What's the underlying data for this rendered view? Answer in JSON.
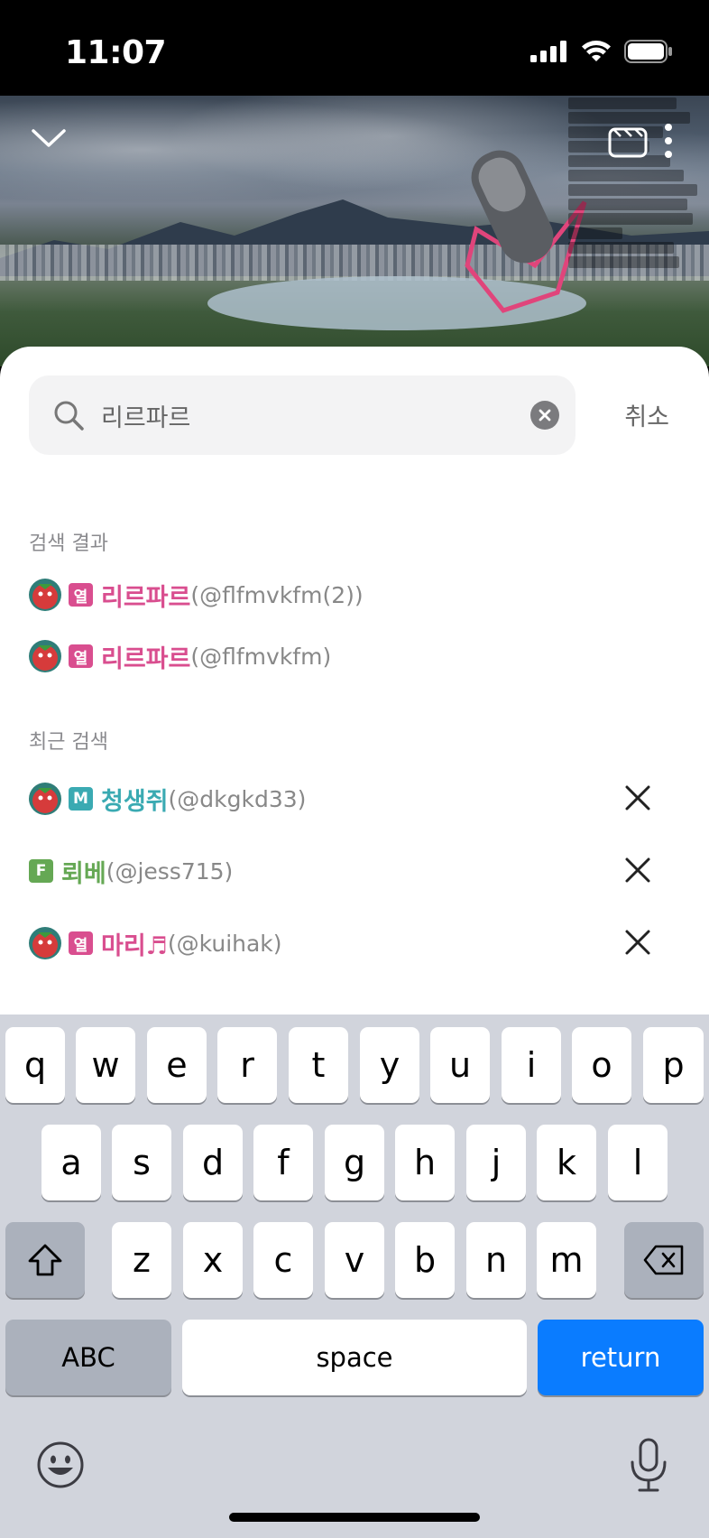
{
  "status": {
    "time": "11:07"
  },
  "search": {
    "value": "리르파르",
    "placeholder": "",
    "cancel_label": "취소"
  },
  "sections": {
    "results_label": "검색 결과",
    "recent_label": "최근 검색"
  },
  "results": [
    {
      "badge": "열",
      "badge_color": "#d94e8f",
      "name": "리르파르",
      "name_color": "#d94e8f",
      "handle": "(@flfmvkfm(2))"
    },
    {
      "badge": "열",
      "badge_color": "#d94e8f",
      "name": "리르파르",
      "name_color": "#d94e8f",
      "handle": "(@flfmvkfm)"
    }
  ],
  "recent": [
    {
      "badge": "M",
      "badge_color": "#3aaab2",
      "name": "청생쥐",
      "name_color": "#3aaab2",
      "handle": "(@dkgkd33)"
    },
    {
      "badge": "F",
      "badge_color": "#65a854",
      "name": "뢰베",
      "name_color": "#65a854",
      "handle": "(@jess715)"
    },
    {
      "badge": "열",
      "badge_color": "#d94e8f",
      "name": "마리♬",
      "name_color": "#d94e8f",
      "handle": "(@kuihak)"
    }
  ],
  "keyboard": {
    "row1": [
      "q",
      "w",
      "e",
      "r",
      "t",
      "y",
      "u",
      "i",
      "o",
      "p"
    ],
    "row2": [
      "a",
      "s",
      "d",
      "f",
      "g",
      "h",
      "j",
      "k",
      "l"
    ],
    "row3": [
      "z",
      "x",
      "c",
      "v",
      "b",
      "n",
      "m"
    ],
    "abc_label": "ABC",
    "space_label": "space",
    "return_label": "return"
  },
  "colors": {
    "accent_pink": "#d94e8f",
    "accent_teal": "#3aaab2",
    "accent_green": "#65a854",
    "return_blue": "#0a7cff"
  },
  "icons": [
    "signal-icon",
    "wifi-icon",
    "battery-icon",
    "chevron-down-icon",
    "clip-icon",
    "more-icon",
    "search-icon",
    "clear-icon",
    "close-icon",
    "shift-icon",
    "backspace-icon",
    "emoji-icon",
    "microphone-icon"
  ]
}
